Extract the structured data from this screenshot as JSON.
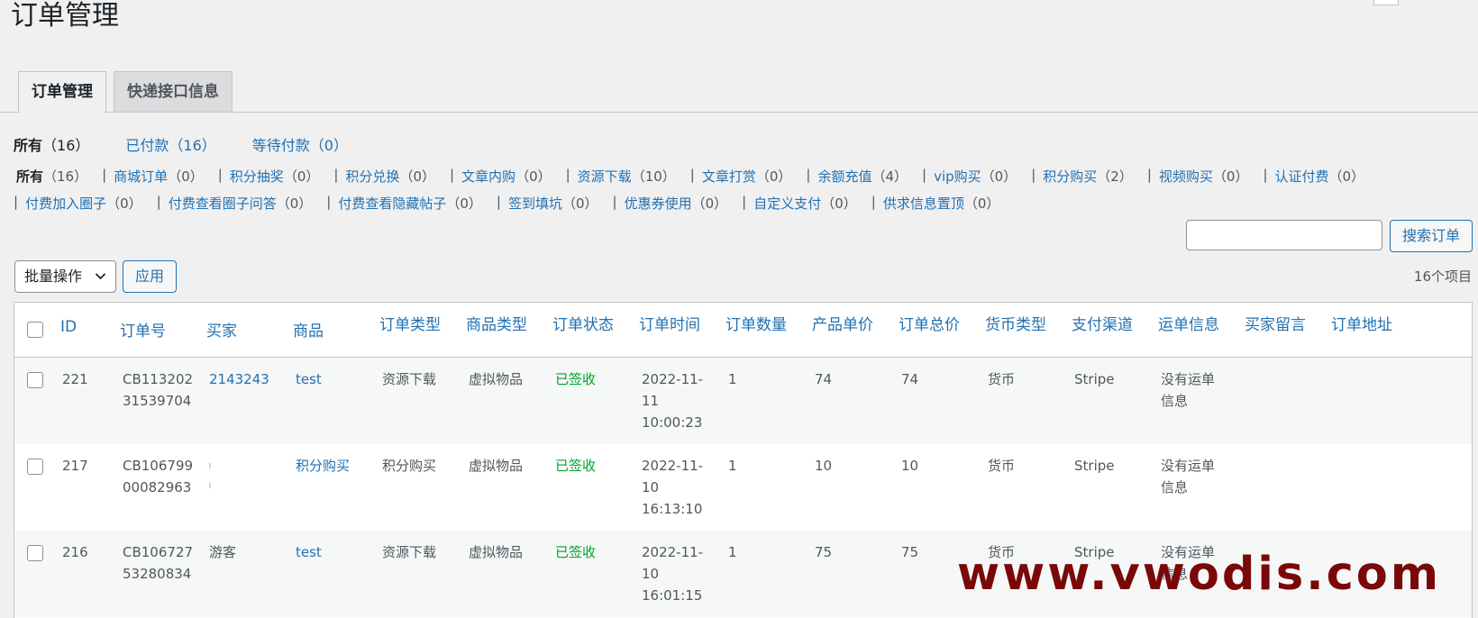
{
  "page": {
    "title": "订单管理"
  },
  "tabs": [
    {
      "label": "订单管理",
      "active": true
    },
    {
      "label": "快递接口信息",
      "active": false
    }
  ],
  "status_filters": [
    {
      "label": "所有",
      "count": "（16）",
      "current": true
    },
    {
      "label": "已付款",
      "count": "（16）",
      "current": false
    },
    {
      "label": "等待付款",
      "count": "（0）",
      "current": false
    }
  ],
  "type_filters_row1": [
    {
      "label": "所有",
      "count": "（16）",
      "current": true
    },
    {
      "label": "商城订单",
      "count": "（0）"
    },
    {
      "label": "积分抽奖",
      "count": "（0）"
    },
    {
      "label": "积分兑换",
      "count": "（0）"
    },
    {
      "label": "文章内购",
      "count": "（0）"
    },
    {
      "label": "资源下载",
      "count": "（10）"
    },
    {
      "label": "文章打赏",
      "count": "（0）"
    },
    {
      "label": "余额充值",
      "count": "（4）"
    },
    {
      "label": "vip购买",
      "count": "（0）"
    },
    {
      "label": "积分购买",
      "count": "（2）"
    },
    {
      "label": "视频购买",
      "count": "（0）"
    },
    {
      "label": "认证付费",
      "count": "（0）"
    }
  ],
  "type_filters_row2": [
    {
      "label": "付费加入圈子",
      "count": "（0）"
    },
    {
      "label": "付费查看圈子问答",
      "count": "（0）"
    },
    {
      "label": "付费查看隐藏帖子",
      "count": "（0）"
    },
    {
      "label": "签到填坑",
      "count": "（0）"
    },
    {
      "label": "优惠券使用",
      "count": "（0）"
    },
    {
      "label": "自定义支付",
      "count": "（0）"
    },
    {
      "label": "供求信息置顶",
      "count": "（0）"
    }
  ],
  "filter_separator": "|",
  "search": {
    "button_label": "搜索订单",
    "value": ""
  },
  "bulk": {
    "select_label": "批量操作",
    "apply_label": "应用"
  },
  "items_count": "16个项目",
  "table": {
    "columns": [
      "ID",
      "订单号",
      "买家",
      "商品",
      "订单类型",
      "商品类型",
      "订单状态",
      "订单时间",
      "订单数量",
      "产品单价",
      "订单总价",
      "货币类型",
      "支付渠道",
      "运单信息",
      "买家留言",
      "订单地址"
    ],
    "rows": [
      {
        "id": "221",
        "order_no_1": "CB113202",
        "order_no_2": "31539704",
        "buyer": "2143243",
        "product": "test",
        "order_type": "资源下载",
        "product_type": "虚拟物品",
        "status": "已签收",
        "time_1": "2022-11-",
        "time_2": "11",
        "time_3": "10:00:23",
        "qty": "1",
        "unit_price": "74",
        "total": "74",
        "currency": "货币",
        "channel": "Stripe",
        "shipping_1": "没有运单",
        "shipping_2": "信息"
      },
      {
        "id": "217",
        "order_no_1": "CB106799",
        "order_no_2": "00082963",
        "buyer": "",
        "product": "积分购买",
        "order_type": "积分购买",
        "product_type": "虚拟物品",
        "status": "已签收",
        "time_1": "2022-11-",
        "time_2": "10",
        "time_3": "16:13:10",
        "qty": "1",
        "unit_price": "10",
        "total": "10",
        "currency": "货币",
        "channel": "Stripe",
        "shipping_1": "没有运单",
        "shipping_2": "信息"
      },
      {
        "id": "216",
        "order_no_1": "CB106727",
        "order_no_2": "53280834",
        "buyer": "游客",
        "product": "test",
        "order_type": "资源下载",
        "product_type": "虚拟物品",
        "status": "已签收",
        "time_1": "2022-11-",
        "time_2": "10",
        "time_3": "16:01:15",
        "qty": "1",
        "unit_price": "75",
        "total": "75",
        "currency": "货币",
        "channel": "Stripe",
        "shipping_1": "没有运单",
        "shipping_2": "信息"
      }
    ]
  },
  "watermark": "www.vwodis.com",
  "colors": {
    "link": "#2271b1",
    "status_green": "#00a32a",
    "watermark": "#7a0808",
    "background": "#f0f0f1"
  }
}
